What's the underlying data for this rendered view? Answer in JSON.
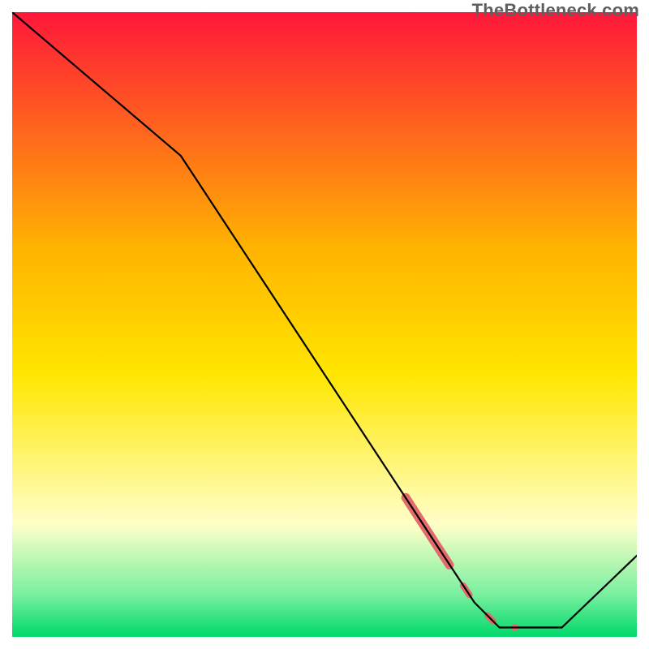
{
  "watermark": "TheBottleneck.com",
  "colors": {
    "curve": "#000000",
    "marker": "#e36b6b",
    "grad_top": "#ff173a",
    "grad_mid1": "#ffb400",
    "grad_mid2": "#ffe600",
    "grad_pale": "#ffffc8",
    "grad_green_soft": "#7cf0a0",
    "grad_green": "#00d96a"
  },
  "chart_data": {
    "type": "line",
    "title": "",
    "xlabel": "",
    "ylabel": "",
    "xlim": [
      0,
      100
    ],
    "ylim": [
      0,
      100
    ],
    "grid": false,
    "legend": false,
    "curve": [
      {
        "x": 0,
        "y": 100
      },
      {
        "x": 27,
        "y": 77
      },
      {
        "x": 74,
        "y": 5.5
      },
      {
        "x": 78,
        "y": 1.5
      },
      {
        "x": 88,
        "y": 1.5
      },
      {
        "x": 100,
        "y": 13
      }
    ],
    "marker_segments": [
      {
        "x1": 63,
        "y1": 22.3,
        "x2": 70,
        "y2": 11.5,
        "w": 11
      },
      {
        "x1": 72.2,
        "y1": 8.2,
        "x2": 73.2,
        "y2": 6.7,
        "w": 8
      },
      {
        "x1": 76.1,
        "y1": 3.4,
        "x2": 77.0,
        "y2": 2.5,
        "w": 8
      }
    ],
    "marker_points": [
      {
        "x": 80.5,
        "y": 1.5,
        "r": 4.5
      }
    ]
  }
}
